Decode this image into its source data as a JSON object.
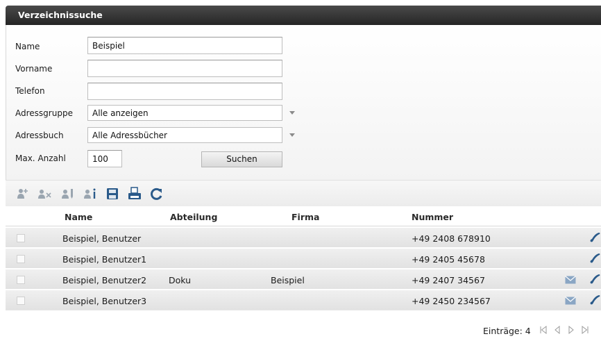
{
  "window": {
    "title": "Verzeichnissuche"
  },
  "form": {
    "name_label": "Name",
    "name_value": "Beispiel",
    "vorname_label": "Vorname",
    "vorname_value": "",
    "telefon_label": "Telefon",
    "telefon_value": "",
    "adressgruppe_label": "Adressgruppe",
    "adressgruppe_value": "Alle anzeigen",
    "adressbuch_label": "Adressbuch",
    "adressbuch_value": "Alle Adressbücher",
    "max_label": "Max. Anzahl",
    "max_value": "100",
    "search_button": "Suchen"
  },
  "toolbar": {
    "icons": [
      "add-contact-icon",
      "remove-contact-icon",
      "edit-contact-icon",
      "contact-info-icon",
      "save-icon",
      "print-icon",
      "refresh-icon"
    ]
  },
  "table": {
    "headers": {
      "name": "Name",
      "abteilung": "Abteilung",
      "firma": "Firma",
      "nummer": "Nummer"
    },
    "rows": [
      {
        "name": "Beispiel, Benutzer",
        "abteilung": "",
        "firma": "",
        "nummer": "+49 2408 678910",
        "mail": false
      },
      {
        "name": "Beispiel, Benutzer1",
        "abteilung": "",
        "firma": "",
        "nummer": "+49 2405 45678",
        "mail": false
      },
      {
        "name": "Beispiel, Benutzer2",
        "abteilung": "Doku",
        "firma": "Beispiel",
        "nummer": "+49 2407 34567",
        "mail": true
      },
      {
        "name": "Beispiel, Benutzer3",
        "abteilung": "",
        "firma": "",
        "nummer": "+49 2450 234567",
        "mail": true
      }
    ]
  },
  "footer": {
    "entries": "Einträge: 4"
  },
  "colors": {
    "titlebar": "#333333",
    "icon_blue": "#2a5a8a",
    "icon_gray": "#9aa5b0"
  }
}
